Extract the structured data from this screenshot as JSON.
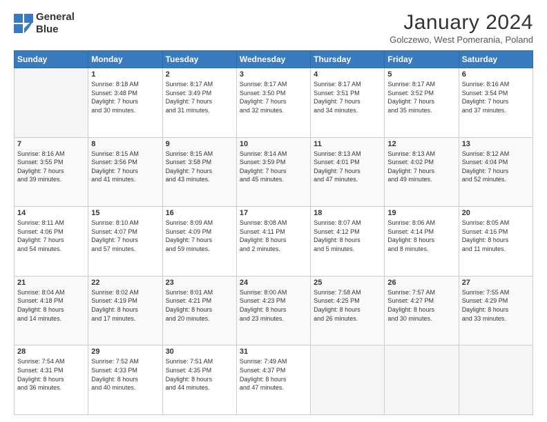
{
  "header": {
    "logo_line1": "General",
    "logo_line2": "Blue",
    "month_title": "January 2024",
    "location": "Golczewo, West Pomerania, Poland"
  },
  "weekdays": [
    "Sunday",
    "Monday",
    "Tuesday",
    "Wednesday",
    "Thursday",
    "Friday",
    "Saturday"
  ],
  "weeks": [
    [
      {
        "day": "",
        "info": ""
      },
      {
        "day": "1",
        "info": "Sunrise: 8:18 AM\nSunset: 3:48 PM\nDaylight: 7 hours\nand 30 minutes."
      },
      {
        "day": "2",
        "info": "Sunrise: 8:17 AM\nSunset: 3:49 PM\nDaylight: 7 hours\nand 31 minutes."
      },
      {
        "day": "3",
        "info": "Sunrise: 8:17 AM\nSunset: 3:50 PM\nDaylight: 7 hours\nand 32 minutes."
      },
      {
        "day": "4",
        "info": "Sunrise: 8:17 AM\nSunset: 3:51 PM\nDaylight: 7 hours\nand 34 minutes."
      },
      {
        "day": "5",
        "info": "Sunrise: 8:17 AM\nSunset: 3:52 PM\nDaylight: 7 hours\nand 35 minutes."
      },
      {
        "day": "6",
        "info": "Sunrise: 8:16 AM\nSunset: 3:54 PM\nDaylight: 7 hours\nand 37 minutes."
      }
    ],
    [
      {
        "day": "7",
        "info": "Sunrise: 8:16 AM\nSunset: 3:55 PM\nDaylight: 7 hours\nand 39 minutes."
      },
      {
        "day": "8",
        "info": "Sunrise: 8:15 AM\nSunset: 3:56 PM\nDaylight: 7 hours\nand 41 minutes."
      },
      {
        "day": "9",
        "info": "Sunrise: 8:15 AM\nSunset: 3:58 PM\nDaylight: 7 hours\nand 43 minutes."
      },
      {
        "day": "10",
        "info": "Sunrise: 8:14 AM\nSunset: 3:59 PM\nDaylight: 7 hours\nand 45 minutes."
      },
      {
        "day": "11",
        "info": "Sunrise: 8:13 AM\nSunset: 4:01 PM\nDaylight: 7 hours\nand 47 minutes."
      },
      {
        "day": "12",
        "info": "Sunrise: 8:13 AM\nSunset: 4:02 PM\nDaylight: 7 hours\nand 49 minutes."
      },
      {
        "day": "13",
        "info": "Sunrise: 8:12 AM\nSunset: 4:04 PM\nDaylight: 7 hours\nand 52 minutes."
      }
    ],
    [
      {
        "day": "14",
        "info": "Sunrise: 8:11 AM\nSunset: 4:06 PM\nDaylight: 7 hours\nand 54 minutes."
      },
      {
        "day": "15",
        "info": "Sunrise: 8:10 AM\nSunset: 4:07 PM\nDaylight: 7 hours\nand 57 minutes."
      },
      {
        "day": "16",
        "info": "Sunrise: 8:09 AM\nSunset: 4:09 PM\nDaylight: 7 hours\nand 59 minutes."
      },
      {
        "day": "17",
        "info": "Sunrise: 8:08 AM\nSunset: 4:11 PM\nDaylight: 8 hours\nand 2 minutes."
      },
      {
        "day": "18",
        "info": "Sunrise: 8:07 AM\nSunset: 4:12 PM\nDaylight: 8 hours\nand 5 minutes."
      },
      {
        "day": "19",
        "info": "Sunrise: 8:06 AM\nSunset: 4:14 PM\nDaylight: 8 hours\nand 8 minutes."
      },
      {
        "day": "20",
        "info": "Sunrise: 8:05 AM\nSunset: 4:16 PM\nDaylight: 8 hours\nand 11 minutes."
      }
    ],
    [
      {
        "day": "21",
        "info": "Sunrise: 8:04 AM\nSunset: 4:18 PM\nDaylight: 8 hours\nand 14 minutes."
      },
      {
        "day": "22",
        "info": "Sunrise: 8:02 AM\nSunset: 4:19 PM\nDaylight: 8 hours\nand 17 minutes."
      },
      {
        "day": "23",
        "info": "Sunrise: 8:01 AM\nSunset: 4:21 PM\nDaylight: 8 hours\nand 20 minutes."
      },
      {
        "day": "24",
        "info": "Sunrise: 8:00 AM\nSunset: 4:23 PM\nDaylight: 8 hours\nand 23 minutes."
      },
      {
        "day": "25",
        "info": "Sunrise: 7:58 AM\nSunset: 4:25 PM\nDaylight: 8 hours\nand 26 minutes."
      },
      {
        "day": "26",
        "info": "Sunrise: 7:57 AM\nSunset: 4:27 PM\nDaylight: 8 hours\nand 30 minutes."
      },
      {
        "day": "27",
        "info": "Sunrise: 7:55 AM\nSunset: 4:29 PM\nDaylight: 8 hours\nand 33 minutes."
      }
    ],
    [
      {
        "day": "28",
        "info": "Sunrise: 7:54 AM\nSunset: 4:31 PM\nDaylight: 8 hours\nand 36 minutes."
      },
      {
        "day": "29",
        "info": "Sunrise: 7:52 AM\nSunset: 4:33 PM\nDaylight: 8 hours\nand 40 minutes."
      },
      {
        "day": "30",
        "info": "Sunrise: 7:51 AM\nSunset: 4:35 PM\nDaylight: 8 hours\nand 44 minutes."
      },
      {
        "day": "31",
        "info": "Sunrise: 7:49 AM\nSunset: 4:37 PM\nDaylight: 8 hours\nand 47 minutes."
      },
      {
        "day": "",
        "info": ""
      },
      {
        "day": "",
        "info": ""
      },
      {
        "day": "",
        "info": ""
      }
    ]
  ]
}
